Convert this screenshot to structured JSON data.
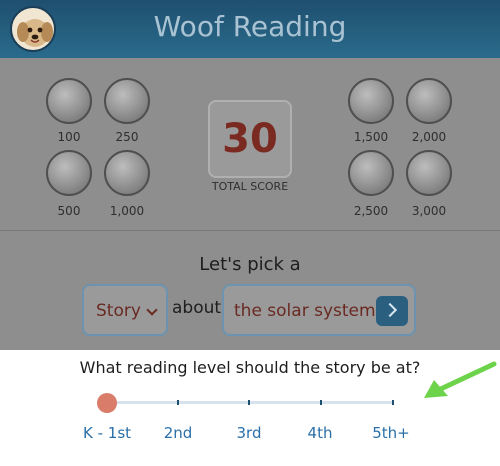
{
  "header": {
    "title": "Woof Reading"
  },
  "badges": {
    "left": [
      {
        "label": "100",
        "icon": "dog-bernese-icon"
      },
      {
        "label": "250",
        "icon": "dog-chihuahua-icon"
      },
      {
        "label": "500",
        "icon": "dog-doodle-icon"
      },
      {
        "label": "1,000",
        "icon": "dog-boxer-icon"
      }
    ],
    "right": [
      {
        "label": "1,500",
        "icon": "dog-husky-icon"
      },
      {
        "label": "2,000",
        "icon": "dog-retriever-icon"
      },
      {
        "label": "2,500",
        "icon": "cat-icon"
      },
      {
        "label": "3,000",
        "icon": "trophy-dog-icon"
      }
    ]
  },
  "score": {
    "value": "30",
    "label": "TOTAL SCORE"
  },
  "story_builder": {
    "prompt": "Let's pick a",
    "type_value": "Story",
    "about_text": "about",
    "topic_value": "the solar system"
  },
  "reading_level": {
    "question": "What reading level should the story be at?",
    "levels": [
      "K - 1st",
      "2nd",
      "3rd",
      "4th",
      "5th+"
    ],
    "selected": "K - 1st"
  },
  "colors": {
    "header": "#1f4f6f",
    "accent": "#2a6fa8",
    "thumb": "#d97d6a",
    "score": "#7a2a20",
    "arrow": "#6cd34a"
  }
}
